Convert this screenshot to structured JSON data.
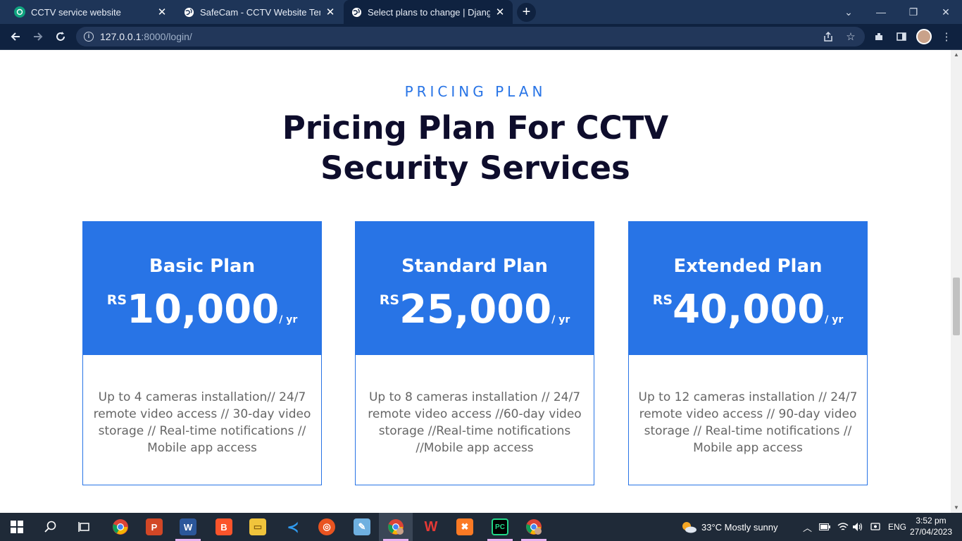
{
  "browser": {
    "tabs": [
      {
        "title": "CCTV service website",
        "favicon": "chatgpt-icon",
        "color": "#10a37f"
      },
      {
        "title": "SafeCam - CCTV Website Templat",
        "favicon": "globe-icon",
        "color": "#ffffff"
      },
      {
        "title": "Select plans to change | Django s",
        "favicon": "globe-icon",
        "color": "#ffffff"
      }
    ],
    "new_tab": "+",
    "url_host": "127.0.0.1",
    "url_path": ":8000/login/"
  },
  "page": {
    "eyebrow": "PRICING PLAN",
    "heading_line1": "Pricing Plan For CCTV",
    "heading_line2": "Security Services",
    "plans": [
      {
        "name": "Basic Plan",
        "currency": "RS",
        "amount": "10,000",
        "period": "/ yr",
        "description": "Up to 4 cameras installation// 24/7 remote video access // 30-day video storage // Real-time notifications // Mobile app access"
      },
      {
        "name": "Standard Plan",
        "currency": "RS",
        "amount": "25,000",
        "period": "/ yr",
        "description": "Up to 8 cameras installation // 24/7 remote video access //60-day video storage //Real-time notifications //Mobile app access"
      },
      {
        "name": "Extended Plan",
        "currency": "RS",
        "amount": "40,000",
        "period": "/ yr",
        "description": "Up to 12 cameras installation // 24/7 remote video access // 90-day video storage // Real-time notifications // Mobile app access"
      }
    ],
    "accent_color": "#2874e6"
  },
  "taskbar": {
    "weather": "33°C  Mostly sunny",
    "language": "ENG",
    "time": "3:52 pm",
    "date": "27/04/2023"
  }
}
